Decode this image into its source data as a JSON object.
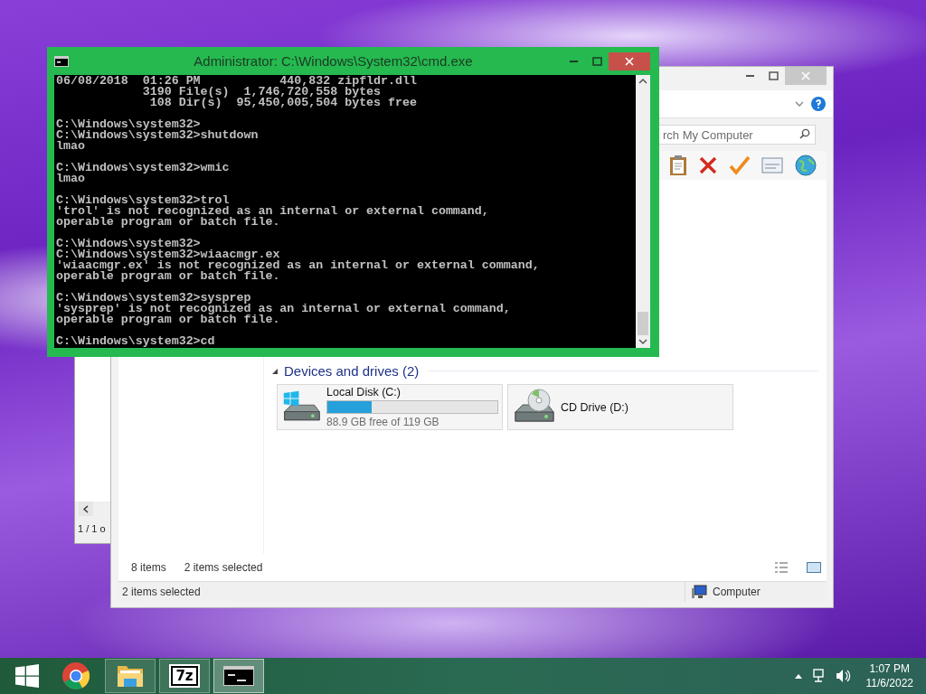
{
  "background_window": {
    "page_indicator": "1 / 1 o"
  },
  "explorer": {
    "active": false,
    "search": {
      "placeholder": "rch My Computer"
    },
    "section": {
      "title": "Devices and drives (2)",
      "expanded": true
    },
    "drives": [
      {
        "kind": "disk",
        "name": "Local Disk (C:)",
        "level": 0.26,
        "reading": "88.9 GB free of 119 GB"
      },
      {
        "kind": "optical",
        "name": "CD Drive (D:)"
      }
    ],
    "item_count": "8 items",
    "selection_count": "2 items selected",
    "status_bar": {
      "left": "2 items selected",
      "right": "Computer"
    }
  },
  "console": {
    "title": "Administrator: C:\\Windows\\System32\\cmd.exe",
    "active": true,
    "blocks": [
      [
        "06/08/2018  01:26 PM           440,832 zipfldr.dll",
        "            3190 File(s)  1,746,720,558 bytes",
        "             108 Dir(s)  95,450,005,504 bytes free"
      ],
      [
        "C:\\Windows\\system32>",
        "C:\\Windows\\system32>shutdown",
        "lmao"
      ],
      [
        "C:\\Windows\\system32>wmic",
        "lmao"
      ],
      [
        "C:\\Windows\\system32>trol",
        "'trol' is not recognized as an internal or external command,",
        "operable program or batch file."
      ],
      [
        "C:\\Windows\\system32>",
        "C:\\Windows\\system32>wiaacmgr.ex",
        "'wiaacmgr.ex' is not recognized as an internal or external command,",
        "operable program or batch file."
      ],
      [
        "C:\\Windows\\system32>sysprep",
        "'sysprep' is not recognized as an internal or external command,",
        "operable program or batch file."
      ],
      [
        "C:\\Windows\\system32>cd"
      ]
    ]
  },
  "taskbar": {
    "apps": [
      {
        "kind": "browser",
        "running": false,
        "selected": false
      },
      {
        "kind": "folder",
        "running": true,
        "selected": false
      },
      {
        "kind": "archiver",
        "label": "7z",
        "running": true,
        "selected": false
      },
      {
        "kind": "console",
        "running": true,
        "selected": true
      }
    ],
    "time": "1:07 PM",
    "date": "11/6/2022"
  }
}
